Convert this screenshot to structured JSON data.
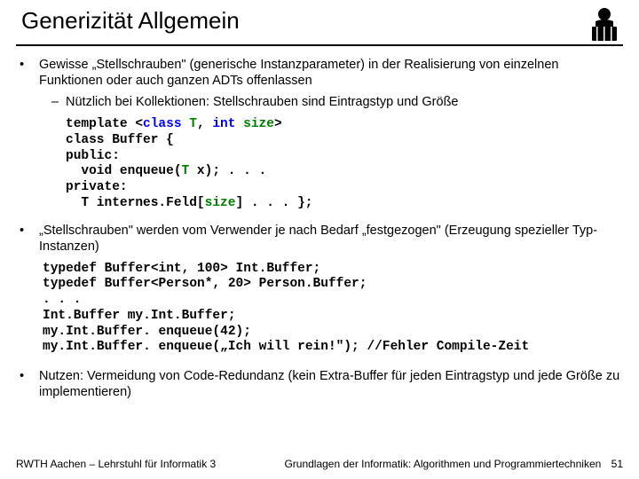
{
  "title": "Generizität Allgemein",
  "bullets": {
    "b1": "Gewisse „Stellschrauben\" (generische Instanzparameter) in der Realisierung von einzelnen Funktionen oder auch ganzen ADTs offenlassen",
    "b1_1": "Nützlich bei Kollektionen: Stellschrauben sind Eintragstyp und Größe",
    "b2": "„Stellschrauben\" werden vom Verwender je nach Bedarf „festgezogen\" (Erzeugung spezieller Typ-Instanzen)",
    "b3": "Nutzen: Vermeidung von Code-Redundanz (kein Extra-Buffer für jeden Eintragstyp und jede Größe zu implementieren)"
  },
  "code1": {
    "l1a": "template <",
    "l1b": "class",
    "l1c": " T",
    "l1d": ", ",
    "l1e": "int",
    "l1f": " size",
    "l1g": ">",
    "l2": "class Buffer {",
    "l3": "public:",
    "l4a": "  void enqueue(",
    "l4b": "T",
    "l4c": " x); . . .",
    "l5": "private:",
    "l6a": "  T internes.Feld[",
    "l6b": "size",
    "l6c": "] . . . };"
  },
  "code2": {
    "l1": "typedef Buffer<int, 100> Int.Buffer;",
    "l2": "typedef Buffer<Person*, 20> Person.Buffer;",
    "l3": ". . .",
    "l4": "Int.Buffer my.Int.Buffer;",
    "l5": "my.Int.Buffer. enqueue(42);",
    "l6": "my.Int.Buffer. enqueue(„Ich will rein!\"); //Fehler Compile-Zeit"
  },
  "footer": {
    "left": "RWTH Aachen – Lehrstuhl für Informatik 3",
    "right": "Grundlagen der Informatik: Algorithmen und Programmiertechniken",
    "page": "51"
  }
}
